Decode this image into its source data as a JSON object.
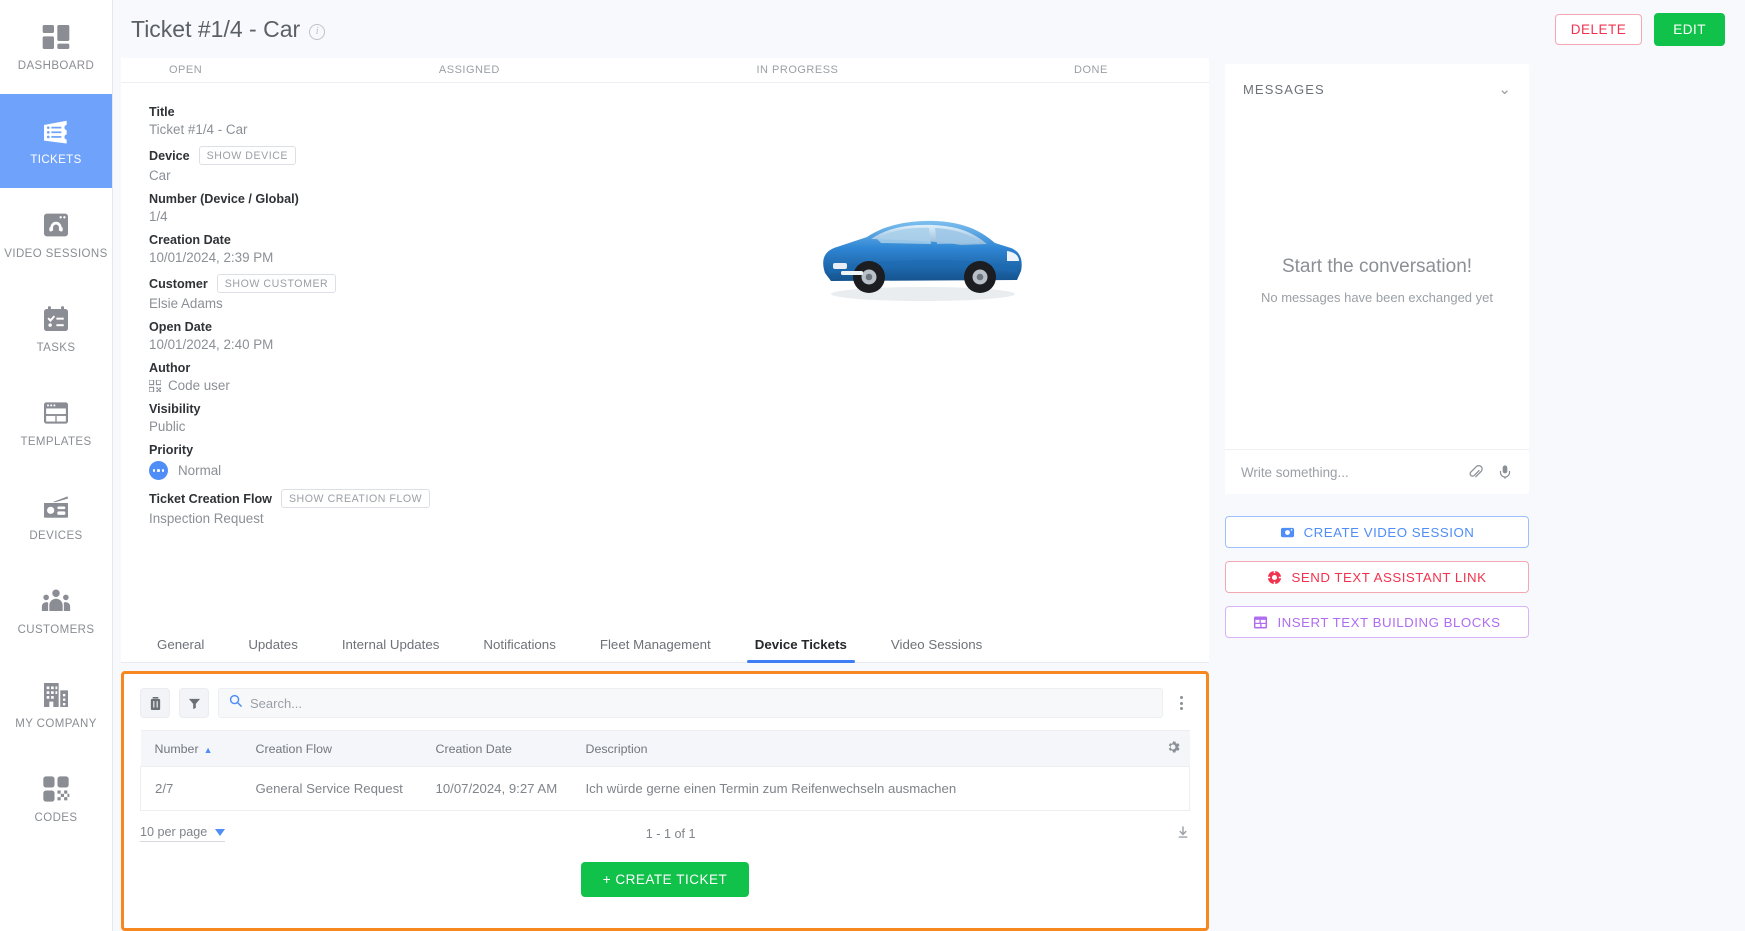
{
  "sidebar": {
    "items": [
      {
        "label": "DASHBOARD",
        "icon": "dashboard-icon",
        "active": false
      },
      {
        "label": "TICKETS",
        "icon": "ticket-icon",
        "active": true
      },
      {
        "label": "VIDEO SESSIONS",
        "icon": "video-session-icon",
        "active": false
      },
      {
        "label": "TASKS",
        "icon": "tasks-icon",
        "active": false
      },
      {
        "label": "TEMPLATES",
        "icon": "templates-icon",
        "active": false
      },
      {
        "label": "DEVICES",
        "icon": "devices-icon",
        "active": false
      },
      {
        "label": "CUSTOMERS",
        "icon": "customers-icon",
        "active": false
      },
      {
        "label": "MY COMPANY",
        "icon": "company-icon",
        "active": false
      },
      {
        "label": "CODES",
        "icon": "codes-icon",
        "active": false
      }
    ],
    "active_color": "#6fa3fb"
  },
  "header": {
    "title": "Ticket #1/4 - Car",
    "info_icon": "info-icon",
    "delete_label": "DELETE",
    "edit_label": "EDIT",
    "delete_color": "#f2334f",
    "edit_color": "#11c24a"
  },
  "status_bar": {
    "steps": [
      "OPEN",
      "ASSIGNED",
      "IN PROGRESS",
      "DONE"
    ]
  },
  "details": {
    "title_label": "Title",
    "title_value": "Ticket #1/4 - Car",
    "device_label": "Device",
    "device_chip": "SHOW DEVICE",
    "device_value": "Car",
    "number_label": "Number (Device / Global)",
    "number_value": "1/4",
    "creation_date_label": "Creation Date",
    "creation_date_value": "10/01/2024, 2:39 PM",
    "customer_label": "Customer",
    "customer_chip": "SHOW CUSTOMER",
    "customer_value": "Elsie Adams",
    "open_date_label": "Open Date",
    "open_date_value": "10/01/2024, 2:40 PM",
    "author_label": "Author",
    "author_value": "Code user",
    "visibility_label": "Visibility",
    "visibility_value": "Public",
    "priority_label": "Priority",
    "priority_value": "Normal",
    "priority_color": "#4f8ef7",
    "flow_label": "Ticket Creation Flow",
    "flow_chip": "SHOW CREATION FLOW",
    "flow_value": "Inspection Request",
    "image_alt": "blue-car-photo"
  },
  "tabs": [
    {
      "label": "General",
      "active": false
    },
    {
      "label": "Updates",
      "active": false
    },
    {
      "label": "Internal Updates",
      "active": false
    },
    {
      "label": "Notifications",
      "active": false
    },
    {
      "label": "Fleet Management",
      "active": false
    },
    {
      "label": "Device Tickets",
      "active": true
    },
    {
      "label": "Video Sessions",
      "active": false
    }
  ],
  "table_panel": {
    "highlight_color": "#f7871f",
    "toolbar": {
      "archive_icon": "archive-icon",
      "filter_icon": "filter-icon",
      "search_placeholder": "Search...",
      "search_value": "",
      "search_icon": "search-icon",
      "kebab_icon": "more-vertical-icon"
    },
    "columns": [
      "Number",
      "Creation Flow",
      "Creation Date",
      "Description"
    ],
    "sort_column": "Number",
    "sort_direction": "asc",
    "settings_icon": "gear-icon",
    "rows": [
      {
        "number": "2/7",
        "creation_flow": "General Service Request",
        "creation_date": "10/07/2024, 9:27 AM",
        "description": "Ich würde gerne einen Termin zum Reifenwechseln ausmachen"
      }
    ],
    "footer": {
      "per_page": "10 per page",
      "range": "1 - 1 of 1",
      "download_icon": "download-icon"
    },
    "create_label": "+ CREATE TICKET",
    "create_color": "#11c24a"
  },
  "messages": {
    "title": "MESSAGES",
    "collapse_icon": "chevron-down-icon",
    "empty_title": "Start the conversation!",
    "empty_subtitle": "No messages have been exchanged yet",
    "input_placeholder": "Write something...",
    "input_value": "",
    "attach_icon": "paperclip-icon",
    "mic_icon": "microphone-icon"
  },
  "panel_actions": [
    {
      "label": "CREATE VIDEO SESSION",
      "icon": "video-camera-icon",
      "color": "#4f8ef7"
    },
    {
      "label": "SEND TEXT ASSISTANT LINK",
      "icon": "lifebuoy-icon",
      "color": "#f2334f"
    },
    {
      "label": "INSERT TEXT BUILDING BLOCKS",
      "icon": "grid-blocks-icon",
      "color": "#b06df0"
    }
  ]
}
